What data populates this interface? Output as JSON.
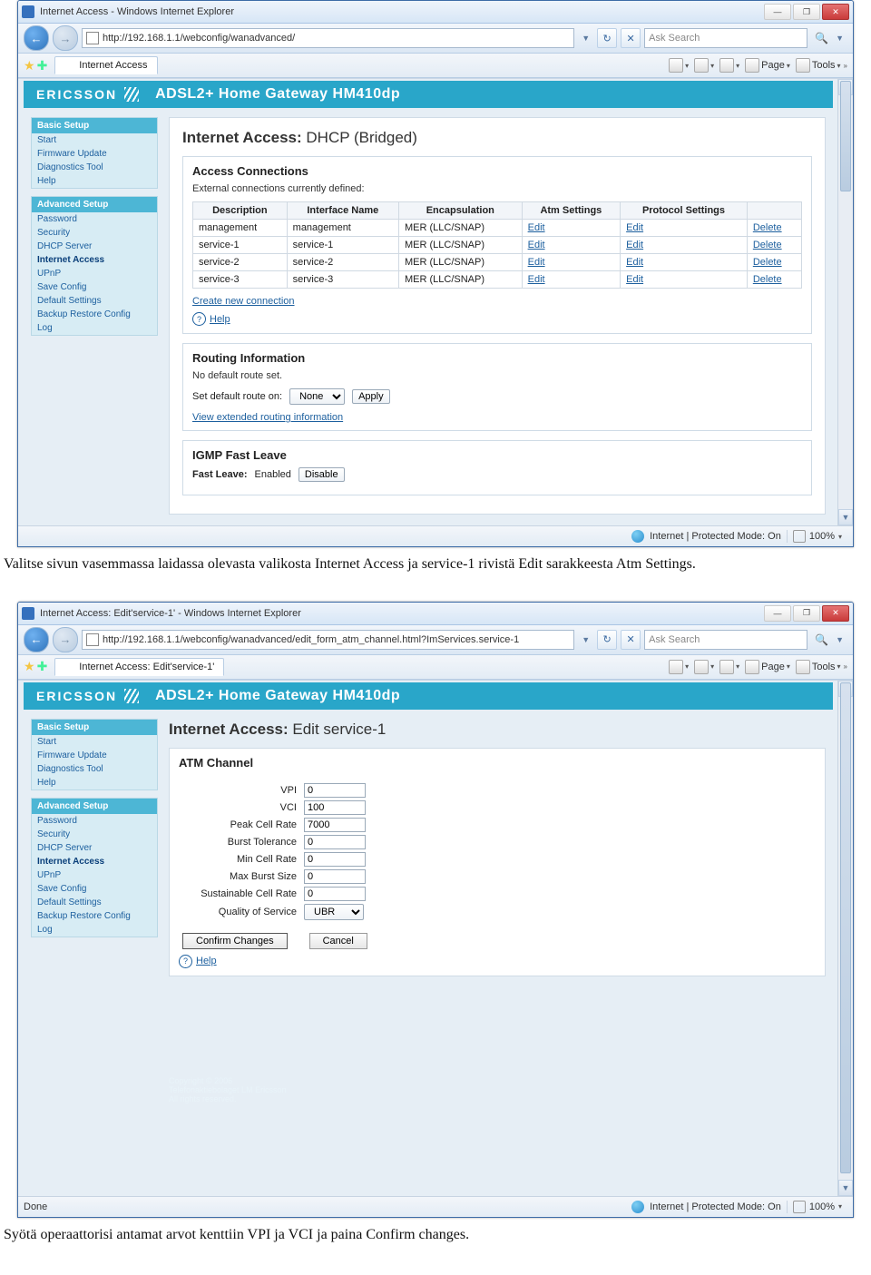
{
  "captions": {
    "after1": "Valitse sivun vasemmassa laidassa olevasta valikosta Internet Access ja service-1 rivistä Edit sarakkeesta Atm Settings.",
    "after2": "Syötä operaattorisi antamat arvot kenttiin VPI ja VCI ja paina Confirm changes."
  },
  "ie_common": {
    "search_placeholder": "Ask Search",
    "toolbar": {
      "page": "Page",
      "tools": "Tools"
    },
    "status": {
      "zone": "Internet | Protected Mode: On",
      "zoom": "100%"
    }
  },
  "win1": {
    "title": "Internet Access - Windows Internet Explorer",
    "url": "http://192.168.1.1/webconfig/wanadvanced/",
    "tab": "Internet Access",
    "status_left": ""
  },
  "win2": {
    "title": "Internet Access: Edit'service-1' - Windows Internet Explorer",
    "url": "http://192.168.1.1/webconfig/wanadvanced/edit_form_atm_channel.html?ImServices.service-1",
    "tab": "Internet Access: Edit'service-1'",
    "status_left": "Done"
  },
  "router": {
    "brand": "ERICSSON",
    "model": "ADSL2+ Home Gateway HM410dp",
    "basic_title": "Basic Setup",
    "basic_items": [
      "Start",
      "Firmware Update",
      "Diagnostics Tool",
      "Help"
    ],
    "adv_title": "Advanced Setup",
    "adv_items": [
      "Password",
      "Security",
      "DHCP Server",
      "Internet Access",
      "UPnP",
      "Save Config",
      "Default Settings",
      "Backup Restore Config",
      "Log"
    ],
    "adv_active_index": 3
  },
  "page1": {
    "h1_b": "Internet Access:",
    "h1_s": "DHCP (Bridged)",
    "p_access": {
      "title": "Access Connections",
      "note": "External connections currently defined:",
      "cols": [
        "Description",
        "Interface Name",
        "Encapsulation",
        "Atm Settings",
        "Protocol Settings",
        ""
      ],
      "rows": [
        {
          "desc": "management",
          "iface": "management",
          "enc": "MER (LLC/SNAP)",
          "atm": "Edit",
          "proto": "Edit",
          "del": "Delete"
        },
        {
          "desc": "service-1",
          "iface": "service-1",
          "enc": "MER (LLC/SNAP)",
          "atm": "Edit",
          "proto": "Edit",
          "del": "Delete"
        },
        {
          "desc": "service-2",
          "iface": "service-2",
          "enc": "MER (LLC/SNAP)",
          "atm": "Edit",
          "proto": "Edit",
          "del": "Delete"
        },
        {
          "desc": "service-3",
          "iface": "service-3",
          "enc": "MER (LLC/SNAP)",
          "atm": "Edit",
          "proto": "Edit",
          "del": "Delete"
        }
      ],
      "create": "Create new connection",
      "help": "Help"
    },
    "p_routing": {
      "title": "Routing Information",
      "note": "No default route set.",
      "set_label": "Set default route on:",
      "select_val": "None",
      "apply": "Apply",
      "ext": "View extended routing information"
    },
    "p_igmp": {
      "title": "IGMP Fast Leave",
      "label": "Fast Leave:",
      "state": "Enabled",
      "btn": "Disable"
    }
  },
  "page2": {
    "h1_b": "Internet Access:",
    "h1_s": "Edit service-1",
    "p_atm": {
      "title": "ATM Channel",
      "fields": {
        "vpi": {
          "label": "VPI",
          "value": "0"
        },
        "vci": {
          "label": "VCI",
          "value": "100"
        },
        "pcr": {
          "label": "Peak Cell Rate",
          "value": "7000"
        },
        "bt": {
          "label": "Burst Tolerance",
          "value": "0"
        },
        "mcr": {
          "label": "Min Cell Rate",
          "value": "0"
        },
        "mbs": {
          "label": "Max Burst Size",
          "value": "0"
        },
        "scr": {
          "label": "Sustainable Cell Rate",
          "value": "0"
        },
        "qos": {
          "label": "Quality of Service",
          "value": "UBR"
        }
      },
      "confirm": "Confirm Changes",
      "cancel": "Cancel",
      "help": "Help"
    },
    "copyright": "Copyright © 2006\nTelefonaktiebolaget LM Ericsson\nAll rights reserved."
  }
}
